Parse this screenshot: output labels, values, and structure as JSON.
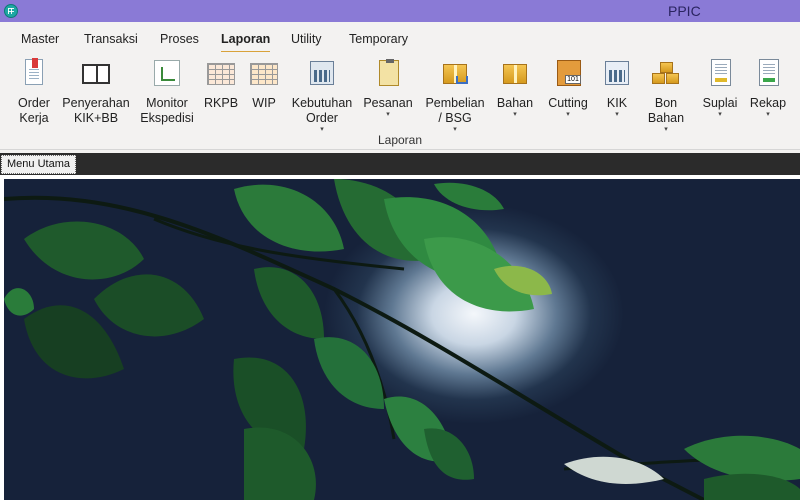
{
  "window": {
    "title": "PPIC"
  },
  "menu": {
    "tabs": [
      "Master",
      "Transaksi",
      "Proses",
      "Laporan",
      "Utility",
      "Temporary"
    ],
    "active": "Laporan"
  },
  "ribbon": {
    "group_label": "Laporan",
    "buttons": [
      {
        "label": "Order\nKerja",
        "icon": "document-report-icon",
        "dropdown": false
      },
      {
        "label": "Penyerahan\nKIK+BB",
        "icon": "book-icon",
        "dropdown": false
      },
      {
        "label": "Monitor\nEkspedisi",
        "icon": "flowchart-icon",
        "dropdown": false
      },
      {
        "label": "RKPB",
        "icon": "spreadsheet-icon",
        "dropdown": false
      },
      {
        "label": "WIP",
        "icon": "spreadsheet-icon",
        "dropdown": false
      },
      {
        "label": "Kebutuhan\nOrder",
        "icon": "calculator-icon",
        "dropdown": true
      },
      {
        "label": "Pesanan",
        "icon": "clipboard-icon",
        "dropdown": true
      },
      {
        "label": "Pembelian\n/ BSG",
        "icon": "box-cart-icon",
        "dropdown": true
      },
      {
        "label": "Bahan",
        "icon": "box-icon",
        "dropdown": true
      },
      {
        "label": "Cutting",
        "icon": "book-101-icon",
        "dropdown": true
      },
      {
        "label": "KIK",
        "icon": "calculator-grid-icon",
        "dropdown": true
      },
      {
        "label": "Bon\nBahan",
        "icon": "boxes-icon",
        "dropdown": true
      },
      {
        "label": "Suplai",
        "icon": "sheet-icon",
        "dropdown": true
      },
      {
        "label": "Rekap",
        "icon": "sheet-green-icon",
        "dropdown": true
      }
    ],
    "cutting_badge": "101",
    "dropdown_glyph": "▾"
  },
  "document_tabs": [
    {
      "label": "Menu Utama"
    }
  ],
  "colors": {
    "titlebar": "#8a7ad6",
    "active_tab_underline": "#d9a23a",
    "doc_strip": "#2b2b2b"
  }
}
